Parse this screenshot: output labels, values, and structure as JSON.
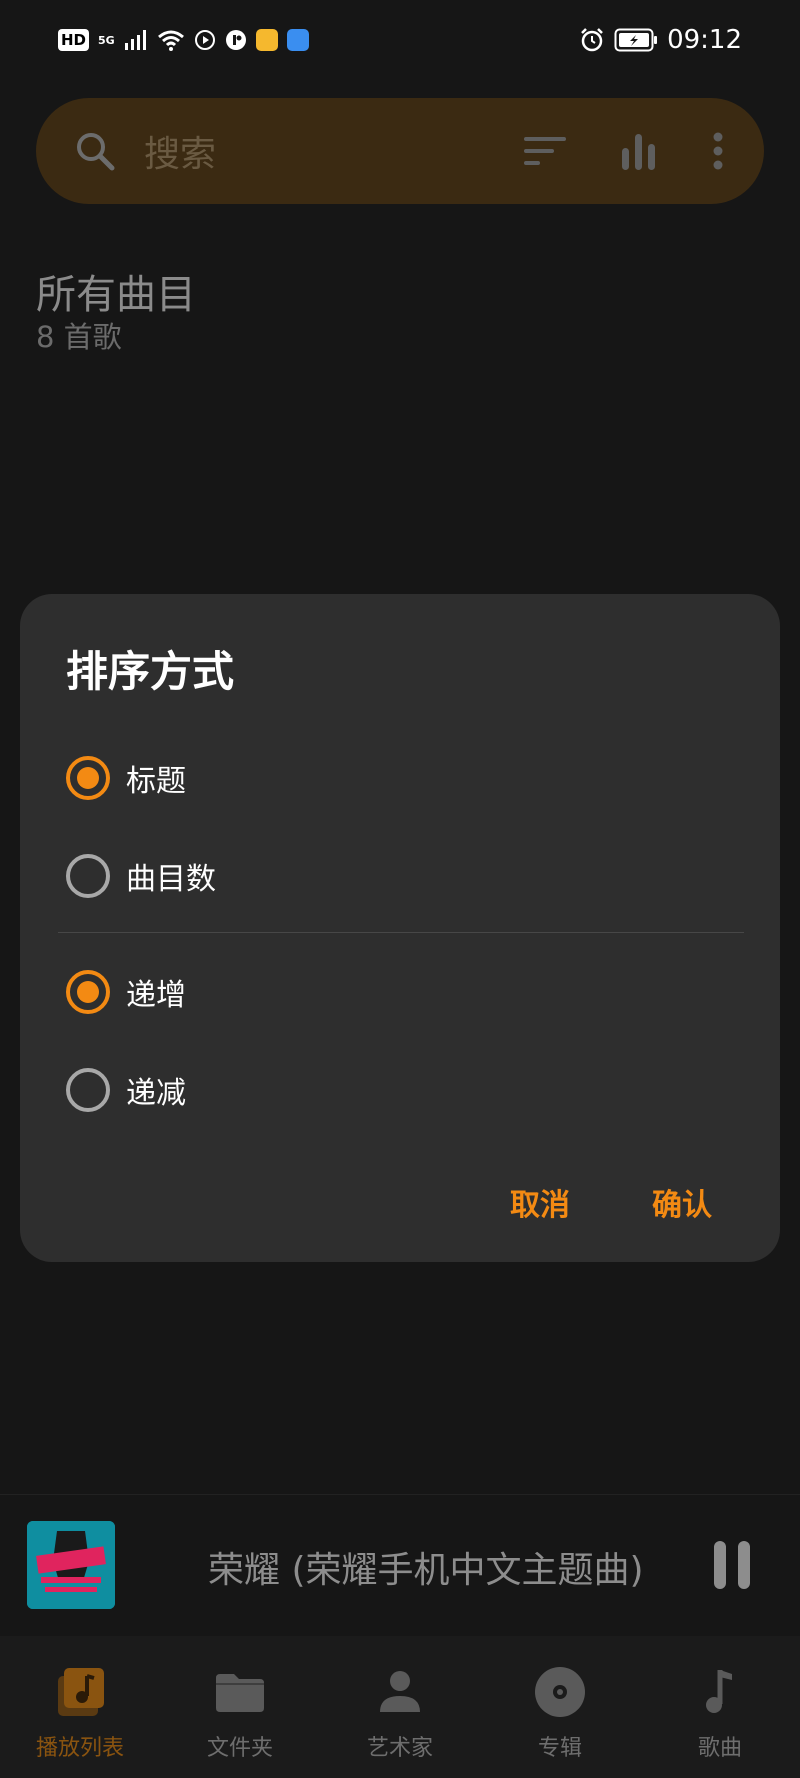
{
  "status_bar": {
    "hd": "HD",
    "network": "5G",
    "time": "09:12"
  },
  "search": {
    "placeholder": "搜索"
  },
  "list": {
    "title": "所有曲目",
    "count": "8 首歌"
  },
  "sort_dialog": {
    "title": "排序方式",
    "sort_by": [
      {
        "label": "标题",
        "checked": true
      },
      {
        "label": "曲目数",
        "checked": false
      }
    ],
    "order": [
      {
        "label": "递增",
        "checked": true
      },
      {
        "label": "递减",
        "checked": false
      }
    ],
    "cancel_label": "取消",
    "confirm_label": "确认"
  },
  "mini_player": {
    "track": "荣耀 (荣耀手机中文主题曲) •"
  },
  "bottom_nav": {
    "items": [
      {
        "label": "播放列表",
        "icon": "playlist-icon",
        "active": true
      },
      {
        "label": "文件夹",
        "icon": "folder-icon",
        "active": false
      },
      {
        "label": "艺术家",
        "icon": "artist-icon",
        "active": false
      },
      {
        "label": "专辑",
        "icon": "album-icon",
        "active": false
      },
      {
        "label": "歌曲",
        "icon": "song-icon",
        "active": false
      }
    ]
  },
  "colors": {
    "accent": "#f38a13",
    "background": "#161616",
    "dialog": "#2e2e2e",
    "search_bar": "#3b2a12"
  }
}
